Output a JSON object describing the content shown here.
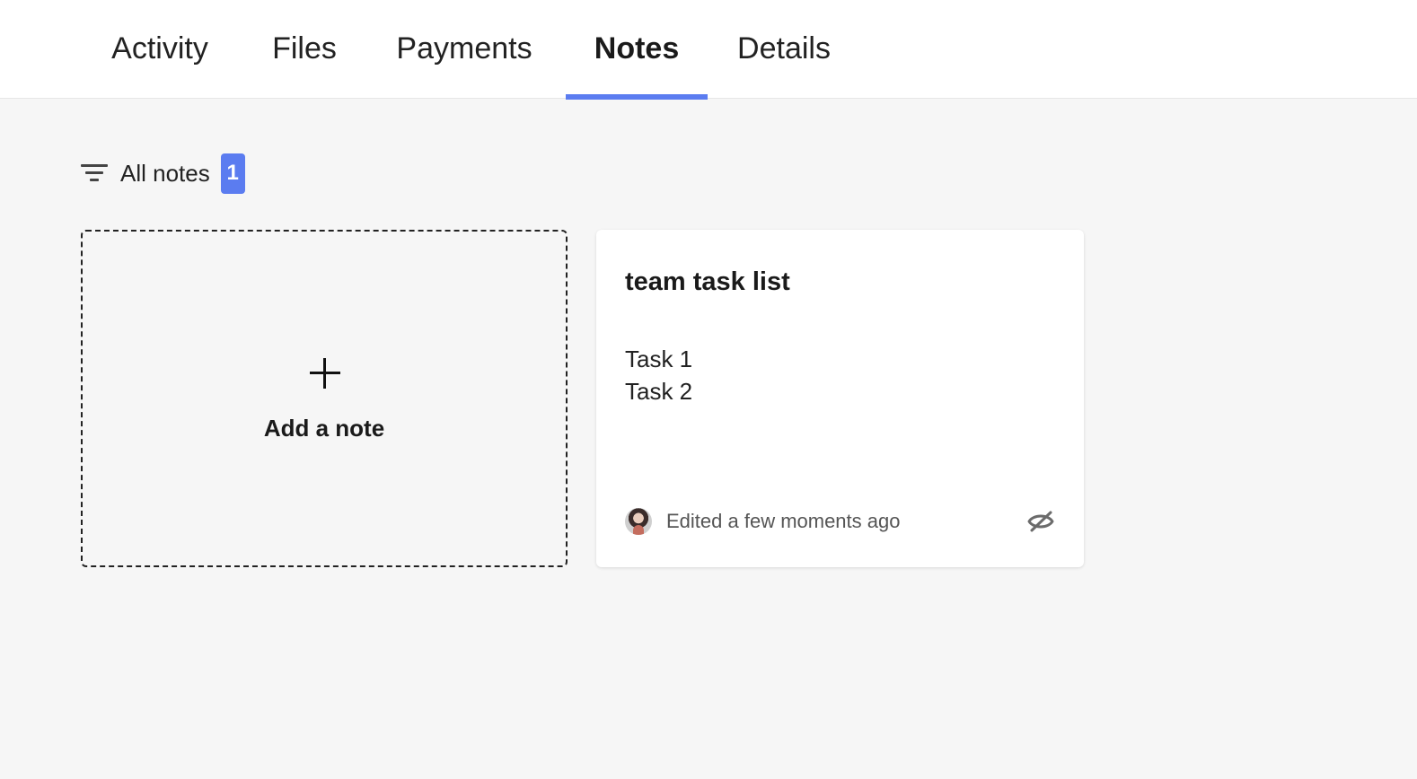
{
  "tabs": [
    {
      "label": "Activity"
    },
    {
      "label": "Files"
    },
    {
      "label": "Payments"
    },
    {
      "label": "Notes",
      "active": true
    },
    {
      "label": "Details"
    }
  ],
  "filter": {
    "label": "All notes",
    "count": "1",
    "icon": "filter-icon"
  },
  "add_note": {
    "icon": "plus-icon",
    "label": "Add a note"
  },
  "note": {
    "title": "team task list",
    "lines": [
      "Task 1",
      "Task 2"
    ],
    "edited": "Edited a few moments ago",
    "avatar": "avatar",
    "visibility_icon": "eye-off-icon"
  },
  "colors": {
    "accent": "#5b7cf0",
    "background": "#f6f6f6",
    "card": "#ffffff"
  }
}
